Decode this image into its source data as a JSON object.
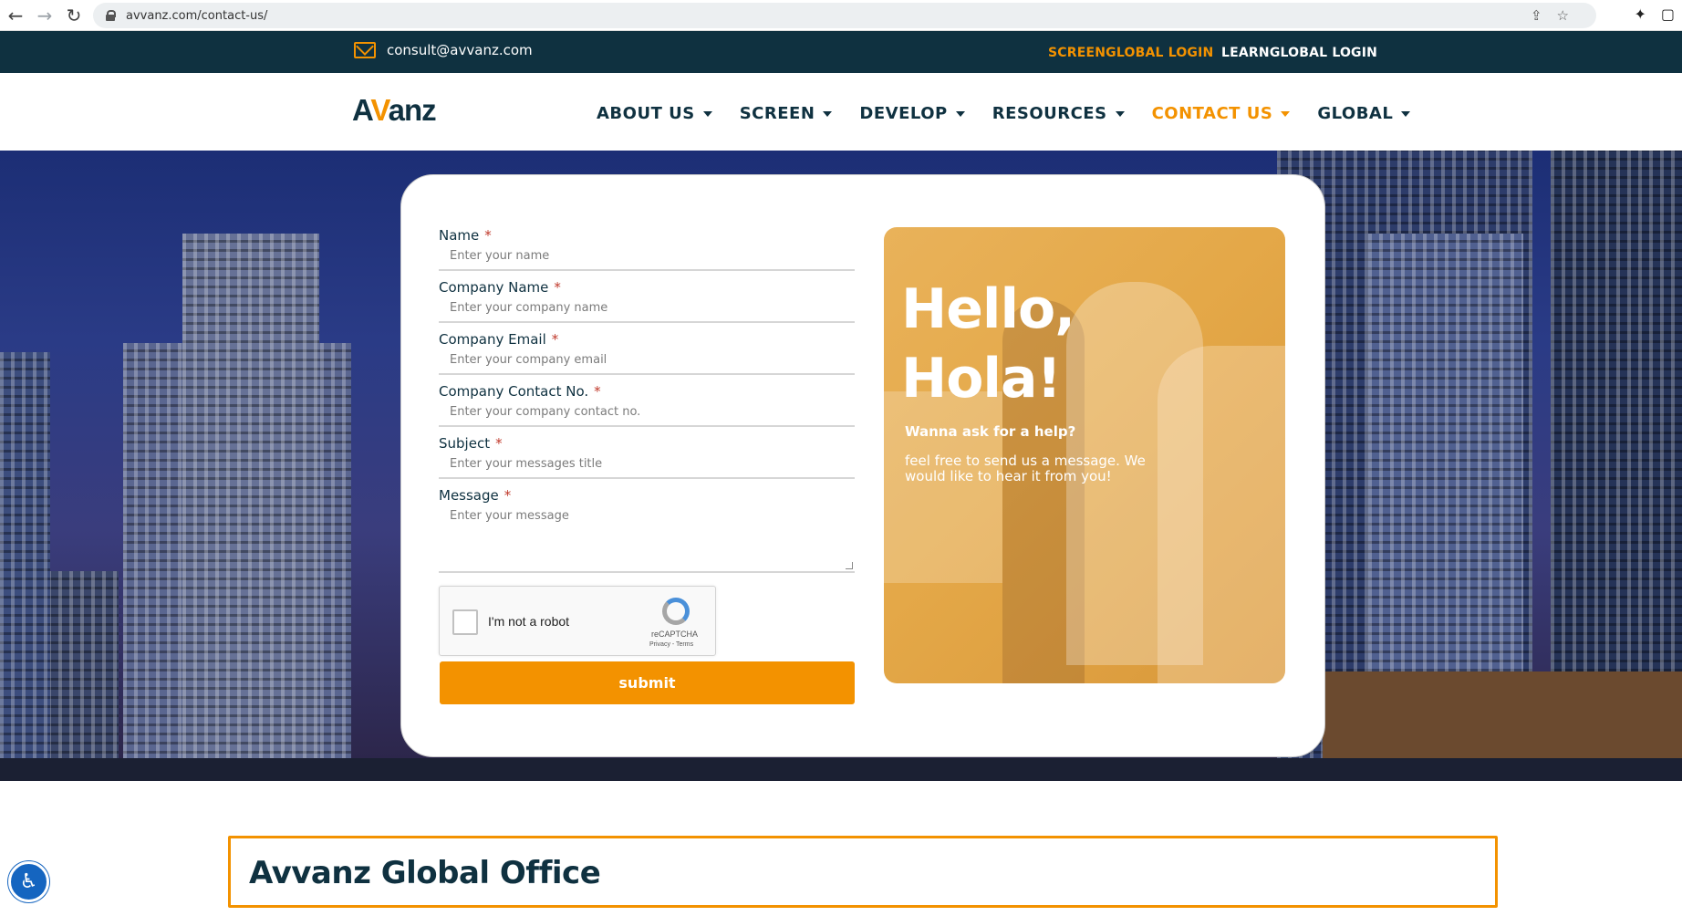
{
  "browser": {
    "url": "avvanz.com/contact-us/"
  },
  "topbar": {
    "email": "consult@avvanz.com",
    "screen_login": "SCREENGLOBAL LOGIN",
    "learn_login": "LEARNGLOBAL LOGIN"
  },
  "header": {
    "logo_a": "A",
    "logo_v": "V",
    "logo_rest": "anz",
    "menu": [
      {
        "label": "ABOUT US"
      },
      {
        "label": "SCREEN"
      },
      {
        "label": "DEVELOP"
      },
      {
        "label": "RESOURCES"
      },
      {
        "label": "CONTACT US"
      },
      {
        "label": "GLOBAL"
      }
    ]
  },
  "form": {
    "fields": [
      {
        "label": "Name",
        "placeholder": "Enter your name"
      },
      {
        "label": "Company Name",
        "placeholder": "Enter your company name"
      },
      {
        "label": "Company Email",
        "placeholder": "Enter your company email"
      },
      {
        "label": "Company Contact No.",
        "placeholder": "Enter your company contact no."
      },
      {
        "label": "Subject",
        "placeholder": "Enter your messages title"
      },
      {
        "label": "Message",
        "placeholder": "Enter your message"
      }
    ],
    "required_mark": "*",
    "recaptcha": {
      "text": "I'm not a robot",
      "brand": "reCAPTCHA",
      "terms": "Privacy - Terms"
    },
    "submit": "submit"
  },
  "promo": {
    "hello_line1": "Hello,",
    "hello_line2": "Hola!",
    "ask": "Wanna ask for a help?",
    "message": "feel free to send us a message. We would like to hear it from you!"
  },
  "office": {
    "title": "Avvanz Global Office"
  },
  "colors": {
    "accent": "#f39200",
    "navy": "#0f3140"
  }
}
